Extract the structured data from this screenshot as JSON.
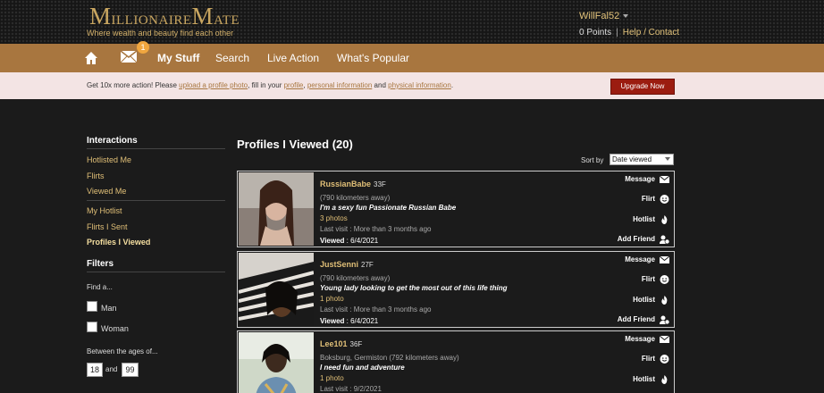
{
  "header": {
    "logo_first": "M",
    "logo_rest": "illionaire",
    "logo_first2": "M",
    "logo_rest2": "ate",
    "tagline": "Where wealth and beauty find each other",
    "username": "WillFal52",
    "points": "0 Points",
    "help_contact": "Help / Contact"
  },
  "nav": {
    "badge": "1",
    "my_stuff": "My Stuff",
    "search": "Search",
    "live_action": "Live Action",
    "whats_popular": "What's Popular"
  },
  "infobar": {
    "text1": "Get 10x more action! Please ",
    "link1": "upload a profile photo",
    "text2": ", fill in your ",
    "link2": "profile",
    "text3": ", ",
    "link3": "personal information",
    "text4": " and ",
    "link4": "physical information",
    "text5": ".",
    "upgrade": "Upgrade Now"
  },
  "sidebar": {
    "interactions_title": "Interactions",
    "hotlisted_me": "Hotlisted Me",
    "flirts": "Flirts",
    "viewed_me": "Viewed Me",
    "my_hotlist": "My Hotlist",
    "flirts_sent": "Flirts I Sent",
    "profiles_viewed": "Profiles I Viewed",
    "filters_title": "Filters",
    "find_a": "Find a...",
    "man": "Man",
    "woman": "Woman",
    "ages_label": "Between the ages of...",
    "age_min": "18",
    "and": "and",
    "age_max": "99"
  },
  "main": {
    "title": "Profiles I Viewed (20)",
    "sort_label": "Sort by",
    "sort_value": "Date viewed",
    "action_labels": {
      "message": "Message",
      "flirt": "Flirt",
      "hotlist": "Hotlist",
      "add_friend": "Add Friend"
    },
    "profiles": [
      {
        "name": "RussianBabe",
        "age": "33F",
        "location": "(790 kilometers away)",
        "headline": "I'm a sexy fun Passionate Russian Babe",
        "photos": "3 photos",
        "last_visit": "Last visit : More than 3 months ago",
        "viewed_label": "Viewed",
        "viewed_date": ": 6/4/2021"
      },
      {
        "name": "JustSenni",
        "age": "27F",
        "location": "(790 kilometers away)",
        "headline": "Young lady looking to get the most out of this life thing",
        "photos": "1 photo",
        "last_visit": "Last visit : More than 3 months ago",
        "viewed_label": "Viewed",
        "viewed_date": ": 6/4/2021"
      },
      {
        "name": "Lee101",
        "age": "36F",
        "location": "Boksburg, Germiston (792 kilometers away)",
        "headline": "I need fun and adventure",
        "photos": "1 photo",
        "last_visit": "Last visit : 9/2/2021",
        "viewed_label": "",
        "viewed_date": ""
      }
    ]
  },
  "colors": {
    "nav_bar": "#a8763f",
    "gold": "#e0bf77",
    "info_bar": "#f3e4e4",
    "upgrade_button": "#9b1c10",
    "background": "#1b1b1b"
  }
}
